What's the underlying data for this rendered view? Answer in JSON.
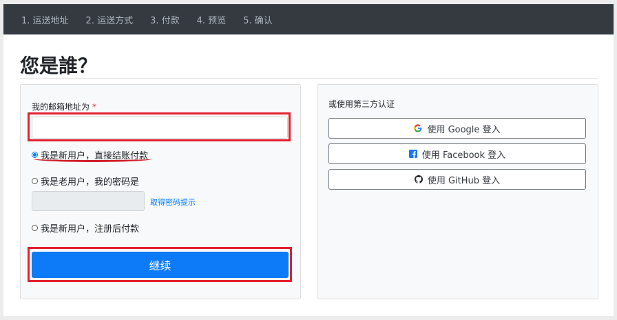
{
  "steps": [
    "1. 运送地址",
    "2. 运送方式",
    "3. 付款",
    "4. 预览",
    "5. 确认"
  ],
  "page_title": "您是誰？",
  "login": {
    "email_label": "我的邮箱地址为",
    "required_mark": "*",
    "email_value": "",
    "option_guest": "我是新用户，直接结账付款",
    "option_existing": "我是老用户，我的密码是",
    "password_value": "",
    "hint_link": "取得密码提示",
    "option_register": "我是新用户，注册后付款",
    "continue_label": "继续"
  },
  "oauth": {
    "label": "或使用第三方认证",
    "google": "使用 Google 登入",
    "facebook": "使用 Facebook 登入",
    "github": "使用 GitHub 登入"
  },
  "colors": {
    "accent": "#0d7bf7",
    "annotation": "#e3202e"
  }
}
